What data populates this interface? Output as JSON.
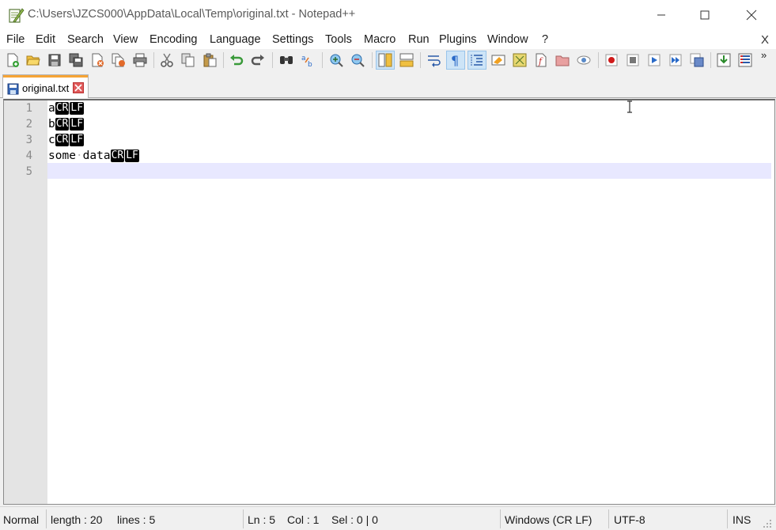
{
  "window": {
    "title": "C:\\Users\\JZCS000\\AppData\\Local\\Temp\\original.txt - Notepad++",
    "icon": "notepadpp-icon"
  },
  "menu": {
    "items": [
      "File",
      "Edit",
      "Search",
      "View",
      "Encoding",
      "Language",
      "Settings",
      "Tools",
      "Macro",
      "Run",
      "Plugins",
      "Window",
      "?"
    ],
    "close_label": "X"
  },
  "toolbar": {
    "more_label": "»",
    "buttons": [
      "new-file",
      "open-file",
      "save",
      "save-all",
      "close",
      "close-all",
      "print",
      "cut",
      "copy",
      "paste",
      "undo",
      "redo",
      "find",
      "replace",
      "zoom-in",
      "zoom-out",
      "sync-vertical",
      "sync-horizontal",
      "word-wrap",
      "show-all-characters",
      "indent-guide",
      "define-language",
      "document-map",
      "function-list",
      "folder-as-workspace",
      "monitoring",
      "start-recording",
      "stop-recording",
      "playback",
      "run-macro-multiple",
      "save-macro",
      "run",
      "plugins-admin"
    ]
  },
  "tab": {
    "label": "original.txt"
  },
  "editor": {
    "line_numbers": [
      "1",
      "2",
      "3",
      "4",
      "5"
    ],
    "lines": [
      {
        "text": "a",
        "eol": [
          "CR",
          "LF"
        ]
      },
      {
        "text": "b",
        "eol": [
          "CR",
          "LF"
        ]
      },
      {
        "text": "c",
        "eol": [
          "CR",
          "LF"
        ]
      },
      {
        "text_parts": [
          "some",
          "·",
          "data"
        ],
        "eol": [
          "CR",
          "LF"
        ]
      },
      {
        "text": "",
        "eol": []
      }
    ],
    "current_line": 5
  },
  "status": {
    "mode": "Normal",
    "length": "length : 20",
    "lines": "lines : 5",
    "ln": "Ln : 5",
    "col": "Col : 1",
    "sel": "Sel : 0 | 0",
    "eol_format": "Windows (CR LF)",
    "encoding": "UTF-8",
    "insert_mode": "INS"
  },
  "colors": {
    "tab_accent": "#f6a435",
    "current_line": "#e8e8ff",
    "gutter": "#e4e4e4"
  }
}
